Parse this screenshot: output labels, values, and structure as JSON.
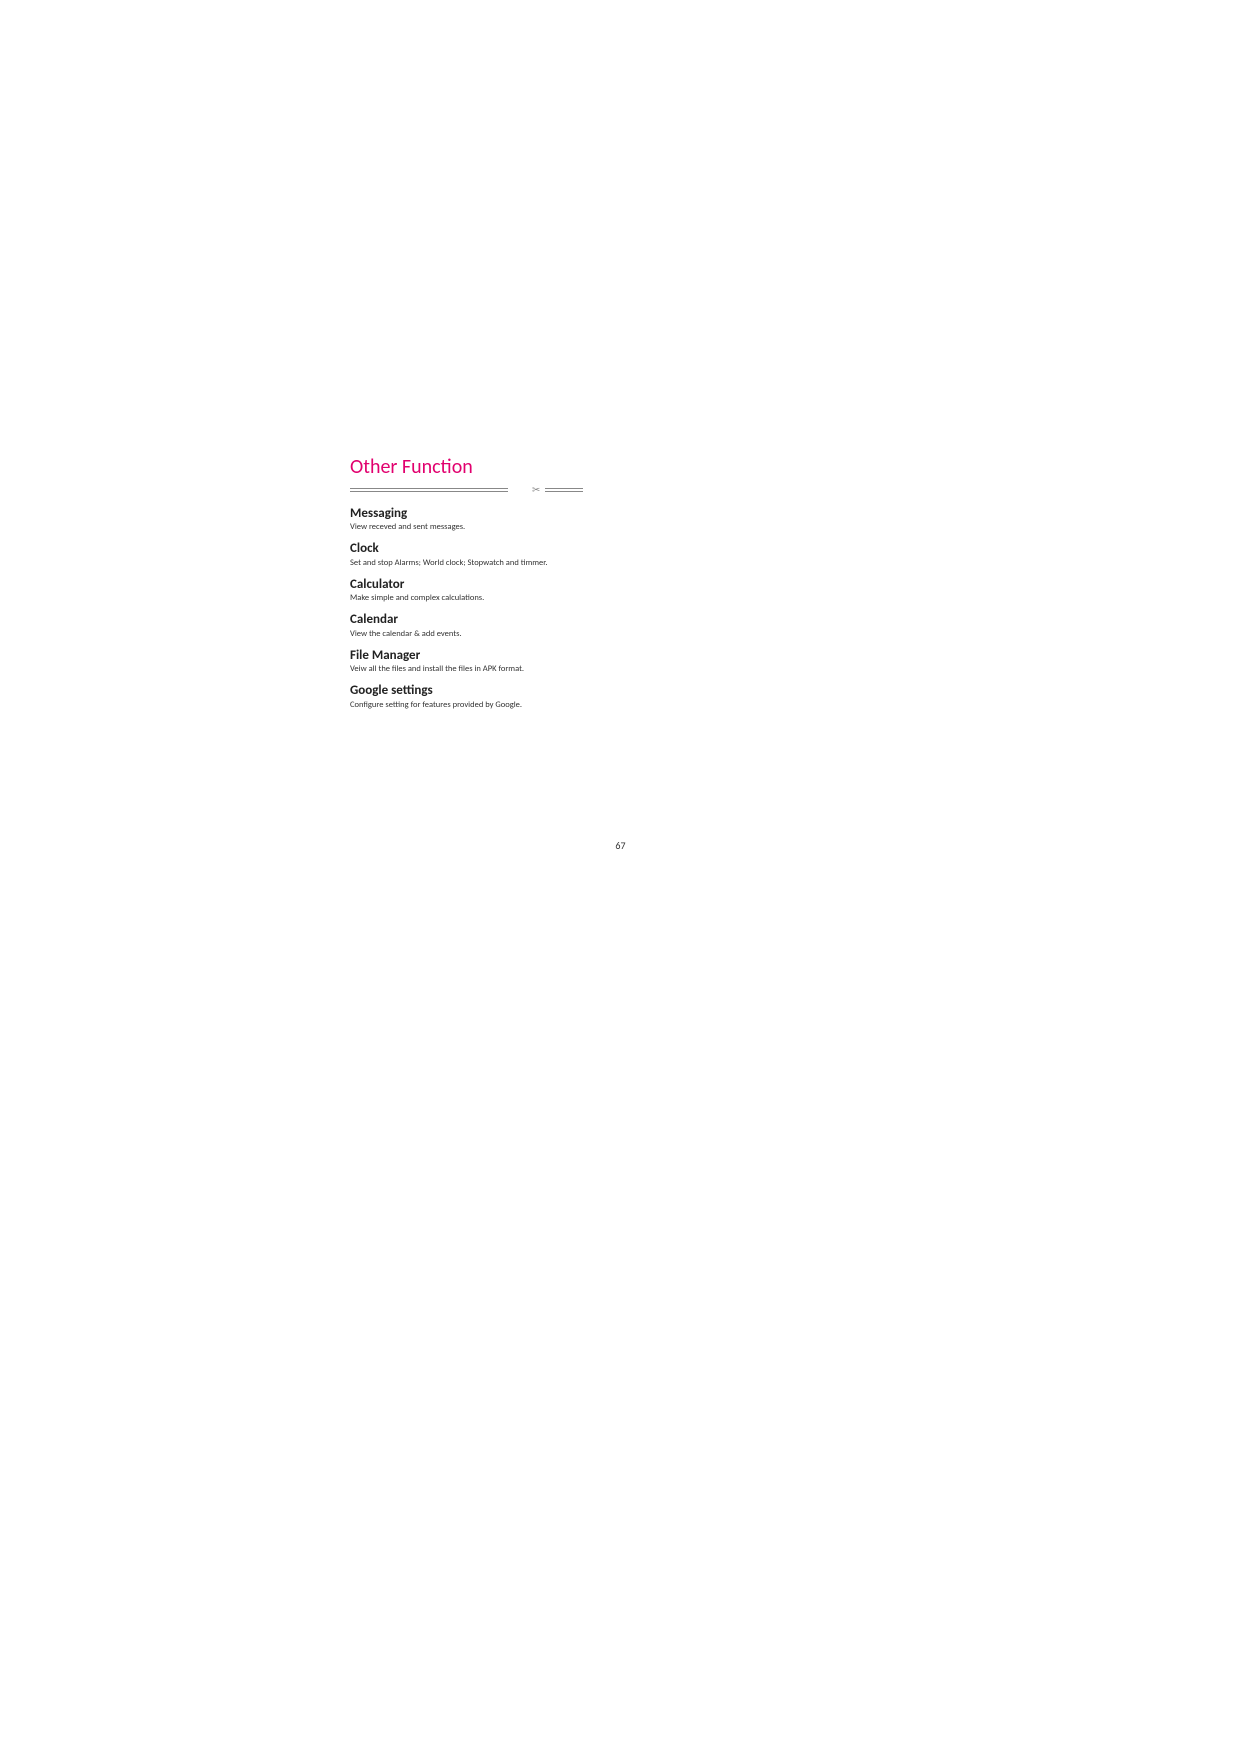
{
  "title": "Other Function",
  "sections": [
    {
      "heading": "Messaging",
      "desc": "View receved and sent messages."
    },
    {
      "heading": "Clock",
      "desc": "Set and stop Alarms; World clock; Stopwatch and timmer."
    },
    {
      "heading": "Calculator",
      "desc": "Make simple and complex calculations."
    },
    {
      "heading": "Calendar",
      "desc": "View the calendar & add events."
    },
    {
      "heading": "File Manager",
      "desc": "Veiw all the files and install the files in APK format."
    },
    {
      "heading": "Google settings",
      "desc": "Configure setting for features provided by Google."
    }
  ],
  "page_number": "67"
}
